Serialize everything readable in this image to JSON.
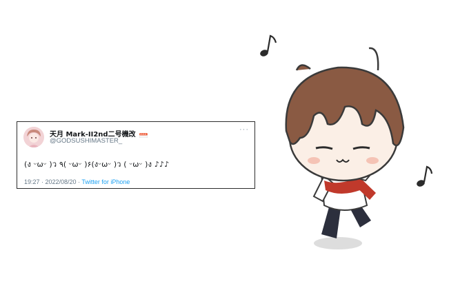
{
  "tweet": {
    "display_name": "天月 Mark-II2nd二号機改",
    "handle": "@GODSUSHIMASTER_",
    "more": "···",
    "text": "(ง ᵕωᵕ )ว ٩( ᵕωᵕ )۶(งᵕωᵕ )ว ( ᵕωᵕ )ง ♪♪♪",
    "timestamp": "19:27 · 2022/08/20 · ",
    "source": "Twitter for iPhone"
  },
  "icons": {
    "avatar": "user-avatar",
    "emoji": "sushi-icon",
    "illustration": "chibi-character-illustration",
    "notes": "music-note-icon"
  },
  "colors": {
    "text": "#14171a",
    "secondary_text": "#657786",
    "link": "#1da1f2",
    "border": "#2b2b2b"
  }
}
